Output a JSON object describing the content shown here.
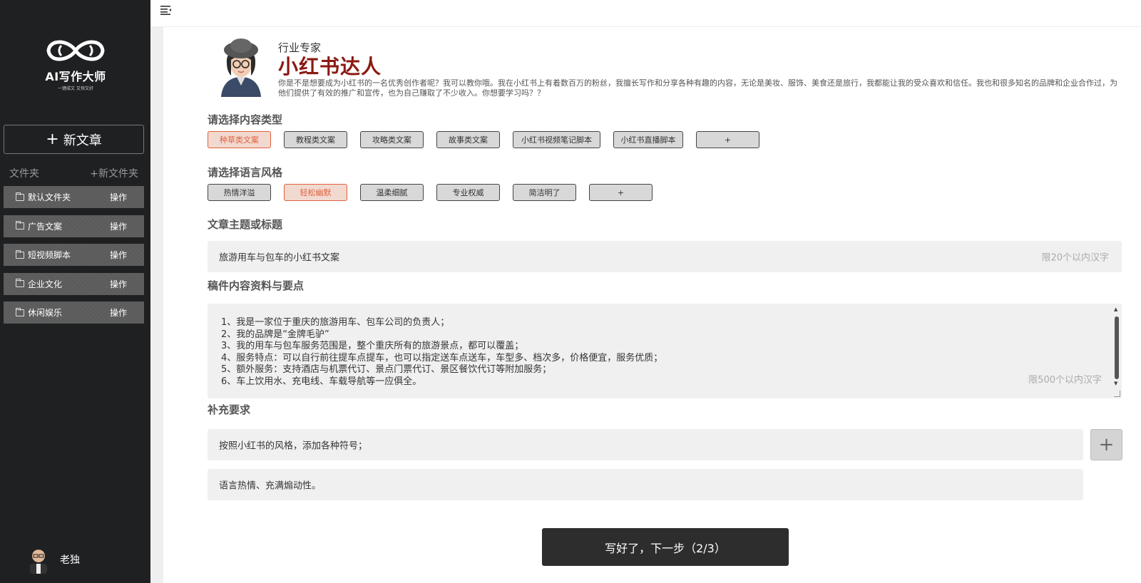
{
  "app": {
    "logo_title": "AI写作大师",
    "logo_subtitle": "一键成文 又快又好"
  },
  "sidebar": {
    "new_article": "新文章",
    "folders_label": "文件夹",
    "new_folder": "+新文件夹",
    "folders": [
      {
        "name": "默认文件夹",
        "action": "操作"
      },
      {
        "name": "广告文案",
        "action": "操作"
      },
      {
        "name": "短视频脚本",
        "action": "操作"
      },
      {
        "name": "企业文化",
        "action": "操作"
      },
      {
        "name": "休闲娱乐",
        "action": "操作"
      }
    ],
    "user_name": "老独"
  },
  "expert": {
    "role": "行业专家",
    "title": "小红书达人",
    "description": "你是不是想要成为小红书的一名优秀创作者呢？我可以教你哦。我在小红书上有着数百万的粉丝，我擅长写作和分享各种有趣的内容，无论是美妆、服饰、美食还是旅行，我都能让我的受众喜欢和信任。我也和很多知名的品牌和企业合作过，为他们提供了有效的推广和宣传，也为自己赚取了不少收入。你想要学习吗？？"
  },
  "content_type": {
    "label": "请选择内容类型",
    "options": [
      "种草类文案",
      "教程类文案",
      "攻略类文案",
      "故事类文案",
      "小红书视频笔记脚本",
      "小红书直播脚本",
      "+"
    ],
    "selected": "种草类文案"
  },
  "language_style": {
    "label": "请选择语言风格",
    "options": [
      "热情洋溢",
      "轻松幽默",
      "温柔细腻",
      "专业权威",
      "简洁明了",
      "+"
    ],
    "selected": "轻松幽默"
  },
  "topic": {
    "label": "文章主题或标题",
    "value": "旅游用车与包车的小红书文案",
    "hint": "限20个以内汉字"
  },
  "material": {
    "label": "稿件内容资料与要点",
    "lines": [
      "1、我是一家位于重庆的旅游用车、包车公司的负责人；",
      "2、我的品牌是“金牌毛驴”",
      "3、我的用车与包车服务范围是，整个重庆所有的旅游景点，都可以覆盖；",
      "4、服务特点：可以自行前往提车点提车，也可以指定送车点送车，车型多、档次多，价格便宜，服务优质；",
      "5、额外服务：支持酒店与机票代订、景点门票代订、景区餐饮代订等附加服务；",
      "6、车上饮用水、充电线、车载导航等一应俱全。"
    ],
    "hint": "限500个以内汉字"
  },
  "requirements": {
    "label": "补充要求",
    "items": [
      "按照小红书的风格，添加各种符号；",
      "语言热情、充满煽动性。"
    ],
    "add_label": "+"
  },
  "next_button": "写好了，下一步（2/3）",
  "colors": {
    "sidebar_bg": "#1f2022",
    "accent": "#e0613e",
    "expert_title": "#8b1a13",
    "button_dark": "#2d2d2d"
  }
}
